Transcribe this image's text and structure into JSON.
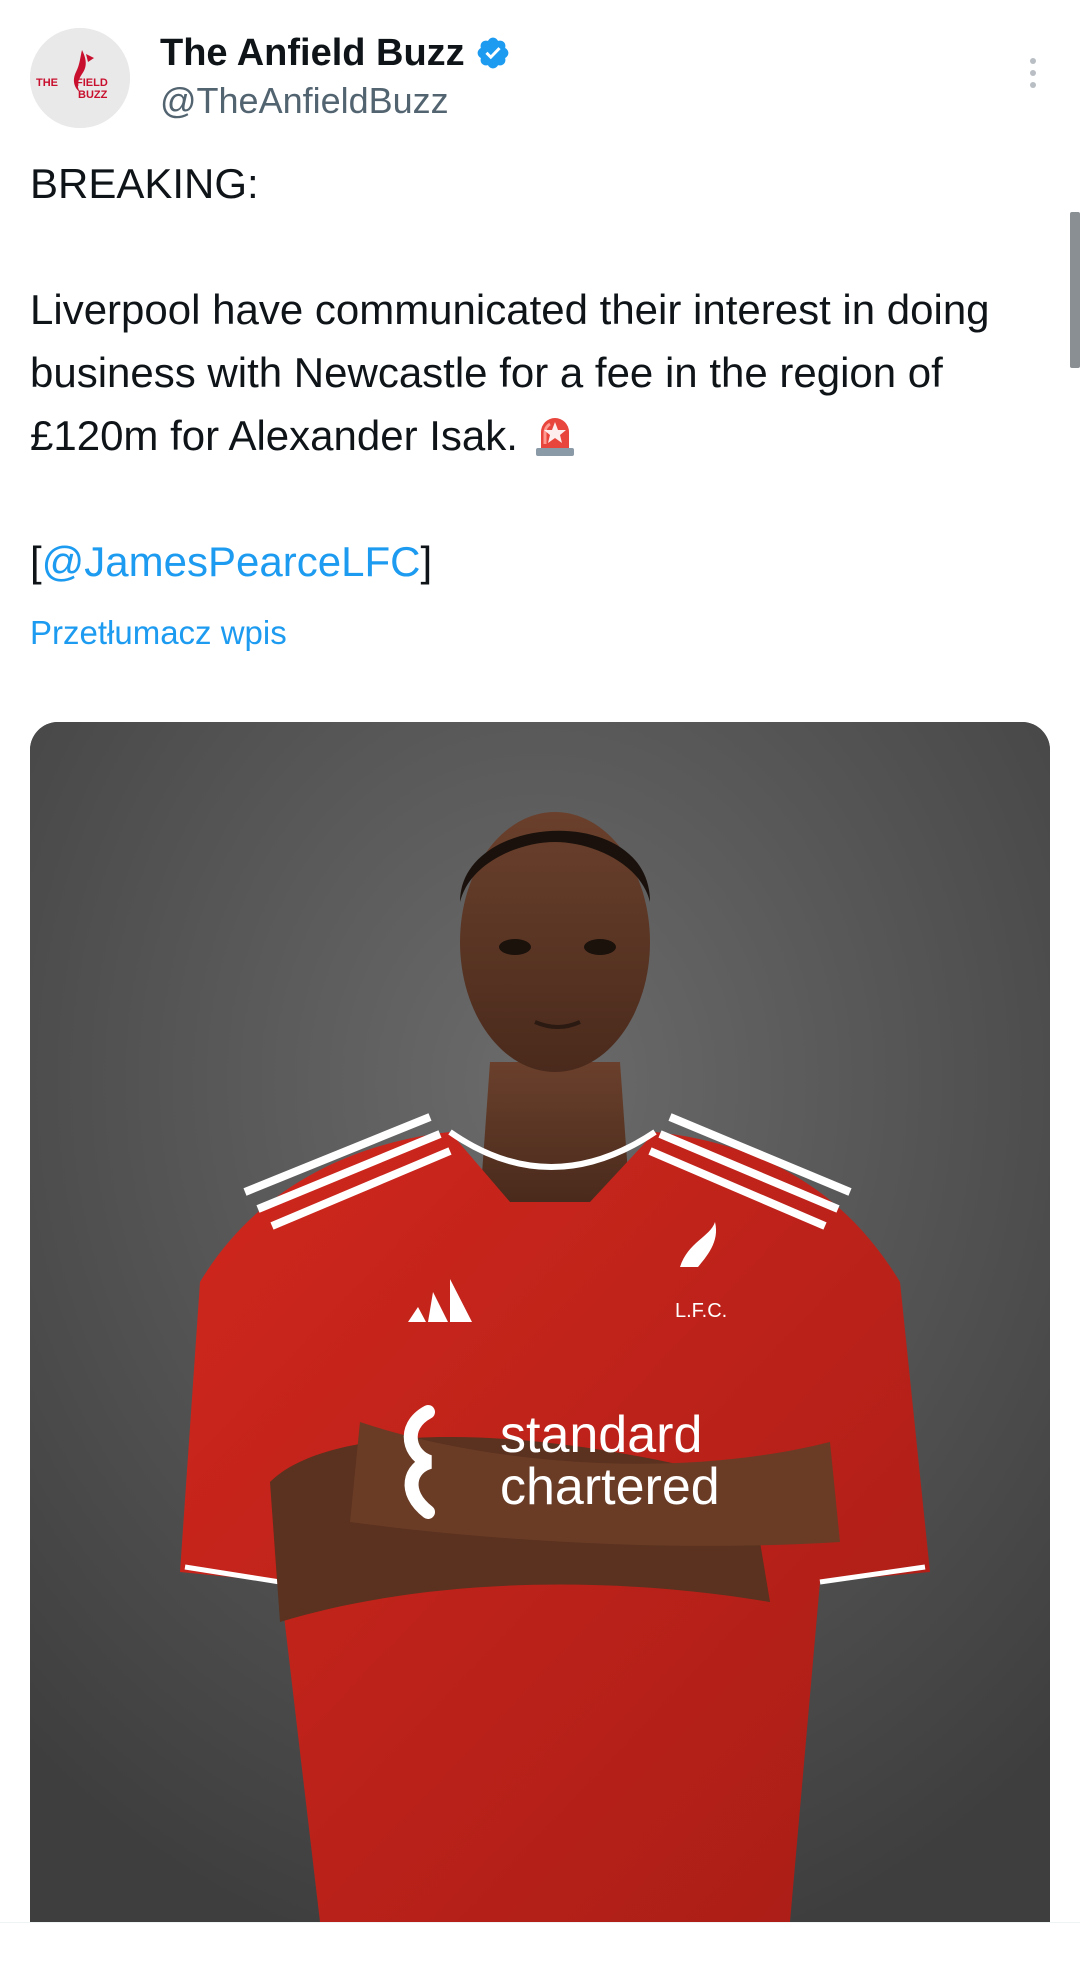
{
  "author": {
    "display_name": "The Anfield Buzz",
    "handle": "@TheAnfieldBuzz",
    "verified": true,
    "avatar_logo_text": "THE ANFIELD BUZZ",
    "avatar_icon": "anfield-buzz-logo"
  },
  "tweet": {
    "line_breaking": "BREAKING:",
    "body": "Liverpool have communicated their interest in doing business with Newcastle for a fee in the region of £120m for Alexander Isak.",
    "emoji_icon": "rotating-light-icon",
    "source_open": "[",
    "source_mention": "@JamesPearceLFC",
    "source_close": "]",
    "translate_link": "Przetłumacz wpis"
  },
  "media": {
    "kit_sponsor_line1": "standard",
    "kit_sponsor_line2": "chartered",
    "kit_crest_text": "L.F.C."
  },
  "colors": {
    "link": "#1d9bf0",
    "verified": "#1d9bf0",
    "text": "#0f1419",
    "secondary_text": "#536471",
    "kit_red": "#c8102e"
  }
}
